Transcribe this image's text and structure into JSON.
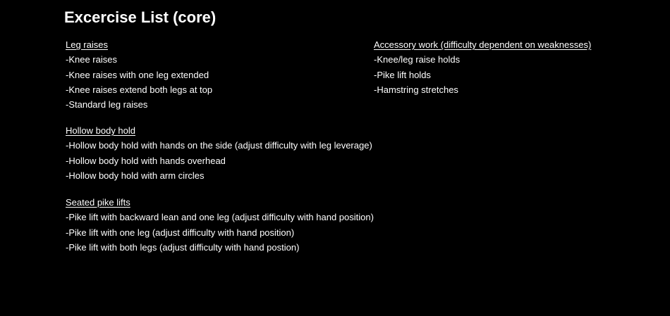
{
  "title": "Excercise List (core)",
  "sections": {
    "leg_raises": {
      "heading": "Leg raises",
      "items": [
        "-Knee raises",
        "-Knee raises with one leg extended",
        "-Knee raises extend both legs at top",
        "-Standard leg raises"
      ]
    },
    "hollow_body": {
      "heading": "Hollow body hold",
      "items": [
        "-Hollow body hold with hands on the side (adjust difficulty with leg leverage)",
        "-Hollow body hold with hands overhead",
        "-Hollow body hold with arm circles"
      ]
    },
    "seated_pike": {
      "heading": "Seated pike lifts",
      "items": [
        "-Pike lift with backward lean and one leg (adjust difficulty with hand position)",
        "-Pike lift with one leg (adjust difficulty with hand position)",
        "-Pike lift with both legs (adjust difficulty with hand postion)"
      ]
    },
    "accessory": {
      "heading": "Accessory work (difficulty dependent on weaknesses)",
      "items": [
        "-Knee/leg raise holds",
        "-Pike lift holds",
        "-Hamstring stretches"
      ]
    }
  }
}
